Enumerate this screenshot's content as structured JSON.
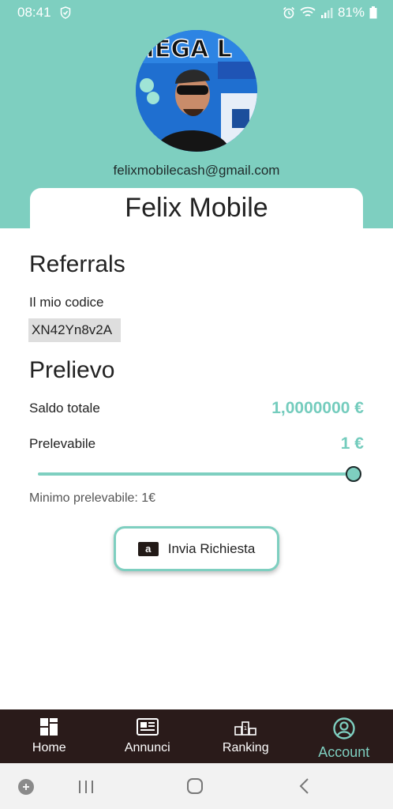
{
  "status_bar": {
    "time": "08:41",
    "battery": "81%"
  },
  "profile": {
    "email": "felixmobilecash@gmail.com",
    "name": "Felix Mobile"
  },
  "referrals": {
    "title": "Referrals",
    "code_label": "Il mio codice",
    "code_value": "XN42Yn8v2A"
  },
  "withdraw": {
    "title": "Prelievo",
    "total_label": "Saldo totale",
    "total_value": "1,0000000 €",
    "withdrawable_label": "Prelevabile",
    "withdrawable_value": "1 €",
    "slider_fraction": 1.0,
    "minimum_text": "Minimo prelevabile: 1€",
    "send_button": "Invia Richiesta",
    "amazon_icon_letter": "a"
  },
  "nav": {
    "items": [
      {
        "label": "Home",
        "icon": "home-grid-icon"
      },
      {
        "label": "Annunci",
        "icon": "newspaper-icon"
      },
      {
        "label": "Ranking",
        "icon": "podium-icon"
      },
      {
        "label": "Account",
        "icon": "account-circle-icon"
      }
    ],
    "active": "Account"
  },
  "colors": {
    "accent": "#7ecfc0",
    "nav_bg": "#2a1b1a",
    "amount": "#74ccbd"
  }
}
